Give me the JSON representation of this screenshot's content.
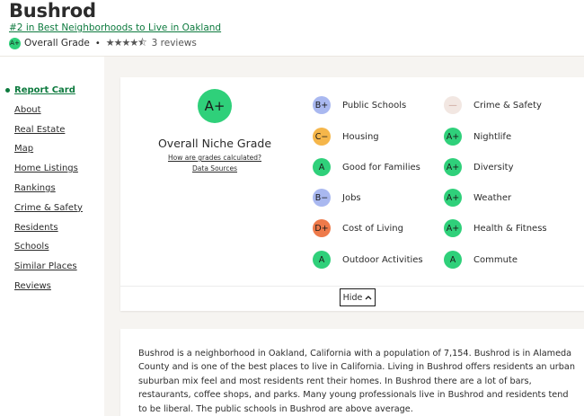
{
  "header": {
    "title": "Bushrod",
    "rank_link": "#2 in Best Neighborhoods to Live in Oakland",
    "grade_badge": "A+",
    "grade_label": "Overall Grade",
    "separator": "•",
    "stars": "★★★★⯪",
    "rating": 4.5,
    "reviews": "3 reviews"
  },
  "sidebar": {
    "items": [
      {
        "label": "Report Card",
        "active": true
      },
      {
        "label": "About"
      },
      {
        "label": "Real Estate"
      },
      {
        "label": "Map"
      },
      {
        "label": "Home Listings"
      },
      {
        "label": "Rankings"
      },
      {
        "label": "Crime & Safety"
      },
      {
        "label": "Residents"
      },
      {
        "label": "Schools"
      },
      {
        "label": "Similar Places"
      },
      {
        "label": "Reviews"
      }
    ]
  },
  "report_card": {
    "overall_grade": "A+",
    "overall_label": "Overall Niche Grade",
    "how_link": "How are grades calculated?",
    "sources_link": "Data Sources",
    "grades_left": [
      {
        "grade": "B+",
        "label": "Public Schools",
        "color": "#a9b8f0"
      },
      {
        "grade": "C−",
        "label": "Housing",
        "color": "#f5b64a"
      },
      {
        "grade": "A",
        "label": "Good for Families",
        "color": "#2fd07a"
      },
      {
        "grade": "B−",
        "label": "Jobs",
        "color": "#a9b8f0"
      },
      {
        "grade": "D+",
        "label": "Cost of Living",
        "color": "#ee7a4a"
      },
      {
        "grade": "A",
        "label": "Outdoor Activities",
        "color": "#2fd07a"
      }
    ],
    "grades_right": [
      {
        "grade": "—",
        "label": "Crime & Safety",
        "color": "#f2e7e2"
      },
      {
        "grade": "A+",
        "label": "Nightlife",
        "color": "#2fd07a"
      },
      {
        "grade": "A+",
        "label": "Diversity",
        "color": "#2fd07a"
      },
      {
        "grade": "A+",
        "label": "Weather",
        "color": "#2fd07a"
      },
      {
        "grade": "A+",
        "label": "Health & Fitness",
        "color": "#2fd07a"
      },
      {
        "grade": "A",
        "label": "Commute",
        "color": "#2fd07a"
      }
    ],
    "hide_label": "Hide",
    "hide_icon": "chevron-up-icon"
  },
  "about": {
    "description": "Bushrod is a neighborhood in Oakland, California with a population of 7,154. Bushrod is in Alameda County and is one of the best places to live in California. Living in Bushrod offers residents an urban suburban mix feel and most residents rent their homes. In Bushrod there are a lot of bars, restaurants, coffee shops, and parks. Many young professionals live in Bushrod and residents tend to be liberal. The public schools in Bushrod are above average."
  }
}
